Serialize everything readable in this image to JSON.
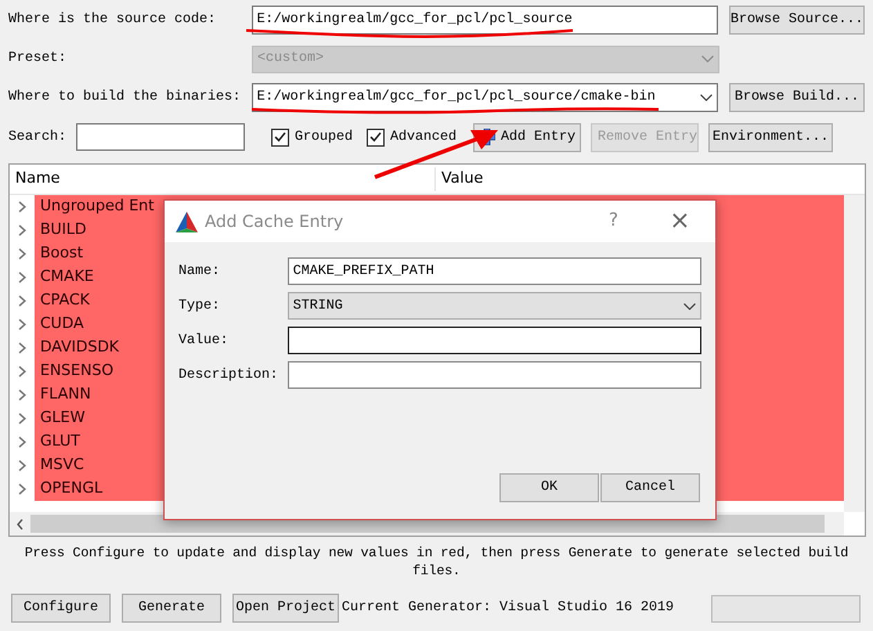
{
  "source": {
    "label": "Where is the source code:",
    "value": "E:/workingrealm/gcc_for_pcl/pcl_source",
    "button": "Browse Source..."
  },
  "preset": {
    "label": "Preset:",
    "value": "<custom>",
    "disabled": true
  },
  "build": {
    "label": "Where to build the binaries:",
    "value": "E:/workingrealm/gcc_for_pcl/pcl_source/cmake-bin",
    "button": "Browse Build..."
  },
  "search": {
    "label": "Search:"
  },
  "checkboxes": [
    {
      "label": "Grouped",
      "checked": true
    },
    {
      "label": "Advanced",
      "checked": true
    }
  ],
  "toolbar": [
    {
      "label": "Add Entry",
      "kind": "add",
      "disabled": false
    },
    {
      "label": "Remove Entry",
      "kind": "remove",
      "disabled": true
    },
    {
      "label": "Environment...",
      "kind": "plain",
      "disabled": false
    }
  ],
  "table": {
    "columns": [
      "Name",
      "Value"
    ],
    "rows": [
      {
        "name": "Ungrouped Ent"
      },
      {
        "name": "BUILD"
      },
      {
        "name": "Boost"
      },
      {
        "name": "CMAKE"
      },
      {
        "name": "CPACK"
      },
      {
        "name": "CUDA"
      },
      {
        "name": "DAVIDSDK"
      },
      {
        "name": "ENSENSO"
      },
      {
        "name": "FLANN"
      },
      {
        "name": "GLEW"
      },
      {
        "name": "GLUT"
      },
      {
        "name": "MSVC"
      },
      {
        "name": "OPENGL"
      }
    ]
  },
  "dialog": {
    "title": "Add Cache Entry",
    "help": "?",
    "close": "×",
    "fields": [
      {
        "label": "Name:",
        "kind": "input",
        "value": "CMAKE_PREFIX_PATH",
        "focused": false
      },
      {
        "label": "Type:",
        "kind": "select",
        "value": "STRING"
      },
      {
        "label": "Value:",
        "kind": "input",
        "focused": true
      },
      {
        "label": "Description:",
        "kind": "input",
        "focused": false
      }
    ],
    "buttons": [
      "OK",
      "Cancel"
    ]
  },
  "status": "Press Configure to update and display new values in red, then press Generate to generate selected build files.",
  "buttons": [
    "Configure",
    "Generate",
    "Open Project"
  ],
  "generator": "Current Generator: Visual Studio 16 2019",
  "progress": {
    "level": 0
  }
}
